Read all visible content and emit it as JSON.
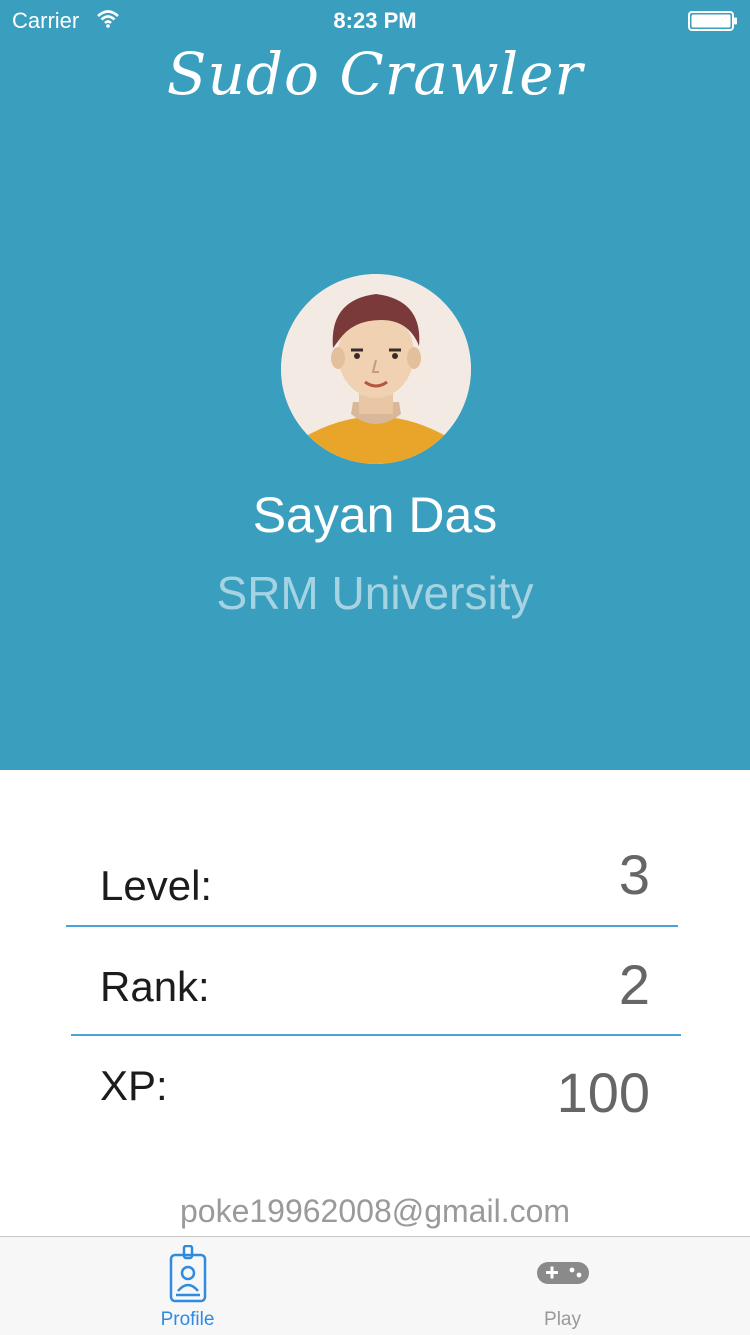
{
  "status_bar": {
    "carrier": "Carrier",
    "time": "8:23 PM",
    "wifi_icon": "wifi-icon",
    "battery_icon": "battery-icon"
  },
  "header": {
    "app_title": "Sudo Crawler"
  },
  "profile": {
    "name": "Sayan Das",
    "university": "SRM University",
    "avatar_icon": "user-avatar"
  },
  "stats": [
    {
      "label": "Level:",
      "value": "3"
    },
    {
      "label": "Rank:",
      "value": "2"
    },
    {
      "label": "XP:",
      "value": "100"
    }
  ],
  "email": "poke19962008@gmail.com",
  "tabs": [
    {
      "label": "Profile",
      "icon": "id-badge-icon",
      "active": true
    },
    {
      "label": "Play",
      "icon": "gamepad-icon",
      "active": false
    }
  ],
  "colors": {
    "accent": "#3a9ebf",
    "tab_active": "#2f8be0",
    "divider": "#4aa3d6"
  }
}
